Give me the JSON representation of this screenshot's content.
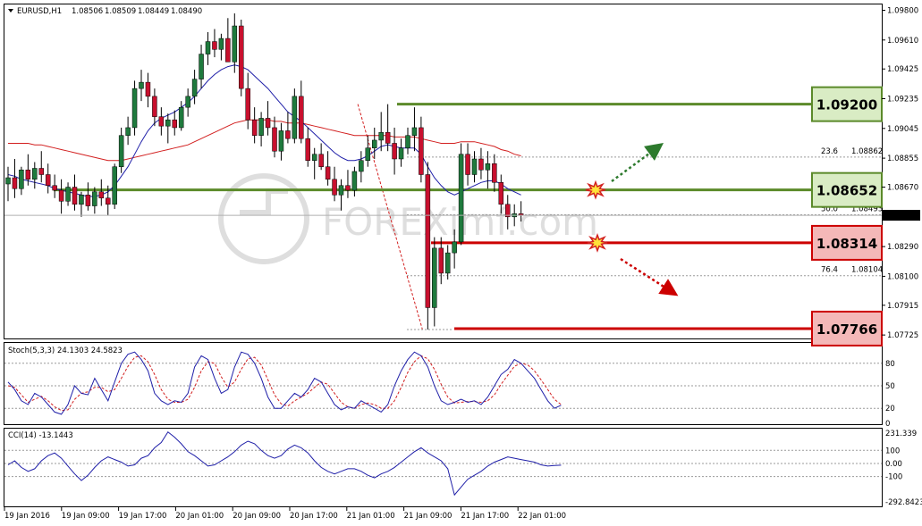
{
  "chart_data": {
    "type": "candlestick",
    "symbol_header": {
      "symbol": "EURUSD,H1",
      "open": "1.08506",
      "high": "1.08509",
      "low": "1.08449",
      "close": "1.08490"
    },
    "watermark": "FOREXimf.com",
    "ylim": [
      1.0772,
      1.0982
    ],
    "price_ticks": [
      "1.09800",
      "1.09610",
      "1.09425",
      "1.09235",
      "1.09045",
      "1.08855",
      "1.08670",
      "1.08490",
      "1.08290",
      "1.08100",
      "1.07915",
      "1.07725"
    ],
    "current_price": "1.08490",
    "x_ticks": [
      "19 Jan 2016",
      "19 Jan 09:00",
      "19 Jan 17:00",
      "20 Jan 01:00",
      "20 Jan 09:00",
      "20 Jan 17:00",
      "21 Jan 01:00",
      "21 Jan 09:00",
      "21 Jan 17:00",
      "22 Jan 01:00"
    ],
    "candles": [
      [
        1.0869,
        1.088,
        1.0858,
        1.0873
      ],
      [
        1.0873,
        1.0885,
        1.086,
        1.0866
      ],
      [
        1.0866,
        1.088,
        1.0862,
        1.0878
      ],
      [
        1.0878,
        1.0888,
        1.0868,
        1.0872
      ],
      [
        1.0872,
        1.0883,
        1.0866,
        1.0879
      ],
      [
        1.0879,
        1.089,
        1.087,
        1.0875
      ],
      [
        1.0875,
        1.0882,
        1.0863,
        1.0868
      ],
      [
        1.0868,
        1.0875,
        1.086,
        1.0865
      ],
      [
        1.0865,
        1.0872,
        1.085,
        1.0858
      ],
      [
        1.0858,
        1.087,
        1.0855,
        1.0867
      ],
      [
        1.0867,
        1.0875,
        1.0852,
        1.0856
      ],
      [
        1.0856,
        1.0864,
        1.0848,
        1.0862
      ],
      [
        1.0862,
        1.087,
        1.0852,
        1.0855
      ],
      [
        1.0855,
        1.0867,
        1.085,
        1.0864
      ],
      [
        1.0864,
        1.0872,
        1.0855,
        1.086
      ],
      [
        1.086,
        1.0868,
        1.0849,
        1.0856
      ],
      [
        1.0856,
        1.0882,
        1.0853,
        1.088
      ],
      [
        1.088,
        1.0905,
        1.0876,
        1.09
      ],
      [
        1.09,
        1.0912,
        1.0894,
        1.0905
      ],
      [
        1.0905,
        1.0935,
        1.09,
        1.093
      ],
      [
        1.093,
        1.0942,
        1.0922,
        1.0934
      ],
      [
        1.0934,
        1.094,
        1.0918,
        1.0925
      ],
      [
        1.0925,
        1.093,
        1.0906,
        1.0912
      ],
      [
        1.0912,
        1.0918,
        1.09,
        1.0906
      ],
      [
        1.0906,
        1.0914,
        1.0895,
        1.091
      ],
      [
        1.091,
        1.0916,
        1.09,
        1.0905
      ],
      [
        1.0905,
        1.0922,
        1.0903,
        1.0918
      ],
      [
        1.0918,
        1.093,
        1.0912,
        1.0925
      ],
      [
        1.0925,
        1.0942,
        1.092,
        1.0936
      ],
      [
        1.0936,
        1.0958,
        1.093,
        1.0952
      ],
      [
        1.0952,
        1.0966,
        1.0945,
        1.096
      ],
      [
        1.096,
        1.0968,
        1.095,
        1.0955
      ],
      [
        1.0955,
        1.0965,
        1.0948,
        1.0962
      ],
      [
        1.0962,
        1.0975,
        1.0955,
        1.0947
      ],
      [
        1.0947,
        1.0978,
        1.094,
        1.097
      ],
      [
        1.097,
        1.0974,
        1.0925,
        1.093
      ],
      [
        1.093,
        1.094,
        1.0904,
        1.091
      ],
      [
        1.091,
        1.0918,
        1.0895,
        1.09
      ],
      [
        1.09,
        1.0915,
        1.0893,
        1.0911
      ],
      [
        1.0911,
        1.0922,
        1.09,
        1.0905
      ],
      [
        1.0905,
        1.0912,
        1.0886,
        1.089
      ],
      [
        1.089,
        1.0908,
        1.0884,
        1.0903
      ],
      [
        1.0903,
        1.0915,
        1.0895,
        1.0898
      ],
      [
        1.0898,
        1.093,
        1.0895,
        1.0925
      ],
      [
        1.0925,
        1.0935,
        1.0895,
        1.0898
      ],
      [
        1.0898,
        1.0905,
        1.088,
        1.0884
      ],
      [
        1.0884,
        1.0892,
        1.0872,
        1.0888
      ],
      [
        1.0888,
        1.0895,
        1.0878,
        1.088
      ],
      [
        1.088,
        1.089,
        1.0868,
        1.0872
      ],
      [
        1.0872,
        1.088,
        1.0858,
        1.0862
      ],
      [
        1.0862,
        1.0872,
        1.0852,
        1.0868
      ],
      [
        1.0868,
        1.0878,
        1.086,
        1.0865
      ],
      [
        1.0865,
        1.088,
        1.0861,
        1.0877
      ],
      [
        1.0877,
        1.089,
        1.087,
        1.0884
      ],
      [
        1.0884,
        1.09,
        1.088,
        1.0892
      ],
      [
        1.0892,
        1.0905,
        1.0885,
        1.0897
      ],
      [
        1.0897,
        1.0915,
        1.089,
        1.0902
      ],
      [
        1.0902,
        1.092,
        1.089,
        1.0895
      ],
      [
        1.0895,
        1.0905,
        1.0875,
        1.0885
      ],
      [
        1.0885,
        1.0898,
        1.088,
        1.0892
      ],
      [
        1.0892,
        1.0905,
        1.0888,
        1.09
      ],
      [
        1.09,
        1.0918,
        1.089,
        1.0905
      ],
      [
        1.0905,
        1.0912,
        1.087,
        1.0875
      ],
      [
        1.0875,
        1.0883,
        1.0776,
        1.079
      ],
      [
        1.079,
        1.0835,
        1.0778,
        1.0828
      ],
      [
        1.0828,
        1.0835,
        1.0805,
        1.0812
      ],
      [
        1.0812,
        1.083,
        1.0808,
        1.0825
      ],
      [
        1.0825,
        1.084,
        1.0815,
        1.0832
      ],
      [
        1.0832,
        1.0895,
        1.083,
        1.0888
      ],
      [
        1.0888,
        1.0895,
        1.0868,
        1.0875
      ],
      [
        1.0875,
        1.089,
        1.087,
        1.0885
      ],
      [
        1.0885,
        1.0892,
        1.0872,
        1.0878
      ],
      [
        1.0878,
        1.089,
        1.0866,
        1.0882
      ],
      [
        1.0882,
        1.0888,
        1.0864,
        1.087
      ],
      [
        1.087,
        1.0875,
        1.085,
        1.0856
      ],
      [
        1.0856,
        1.0862,
        1.084,
        1.0848
      ],
      [
        1.0848,
        1.0856,
        1.0842,
        1.085
      ],
      [
        1.085,
        1.0858,
        1.0845,
        1.0849
      ]
    ],
    "ma_fast": [
      1.0875,
      1.0874,
      1.0872,
      1.0871,
      1.087,
      1.0869,
      1.0868,
      1.0866,
      1.0865,
      1.0864,
      1.0863,
      1.0862,
      1.0861,
      1.0861,
      1.0862,
      1.0864,
      1.0868,
      1.0874,
      1.088,
      1.0888,
      1.0896,
      1.0903,
      1.0908,
      1.0911,
      1.0913,
      1.0915,
      1.0918,
      1.0921,
      1.0925,
      1.093,
      1.0935,
      1.0939,
      1.0942,
      1.0944,
      1.0945,
      1.0944,
      1.0942,
      1.0938,
      1.0934,
      1.093,
      1.0925,
      1.092,
      1.0915,
      1.0912,
      1.0909,
      1.0905,
      1.0901,
      1.0897,
      1.0893,
      1.0889,
      1.0886,
      1.0884,
      1.0884,
      1.0885,
      1.0887,
      1.089,
      1.0893,
      1.0894,
      1.0893,
      1.0892,
      1.0892,
      1.0892,
      1.0888,
      1.088,
      1.0873,
      1.0868,
      1.0864,
      1.0862,
      1.0864,
      1.0866,
      1.0868,
      1.087,
      1.0871,
      1.0871,
      1.0869,
      1.0866,
      1.0864,
      1.0862
    ],
    "ma_slow": [
      1.0895,
      1.0895,
      1.0895,
      1.0895,
      1.0894,
      1.0894,
      1.0893,
      1.0892,
      1.0891,
      1.089,
      1.0889,
      1.0888,
      1.0887,
      1.0886,
      1.0885,
      1.0884,
      1.0884,
      1.0884,
      1.0885,
      1.0886,
      1.0887,
      1.0888,
      1.0889,
      1.089,
      1.0891,
      1.0892,
      1.0893,
      1.0894,
      1.0896,
      1.0898,
      1.09,
      1.0902,
      1.0904,
      1.0906,
      1.0908,
      1.0909,
      1.091,
      1.091,
      1.091,
      1.091,
      1.0909,
      1.0909,
      1.0908,
      1.0908,
      1.0908,
      1.0907,
      1.0906,
      1.0905,
      1.0904,
      1.0903,
      1.0902,
      1.0901,
      1.09,
      1.09,
      1.09,
      1.09,
      1.09,
      1.09,
      1.0899,
      1.0899,
      1.0899,
      1.0899,
      1.0898,
      1.0897,
      1.0896,
      1.0895,
      1.0895,
      1.0895,
      1.0896,
      1.0896,
      1.0896,
      1.0895,
      1.0894,
      1.0893,
      1.0891,
      1.089,
      1.0888,
      1.0887
    ],
    "levels": [
      {
        "label": "1.09200",
        "price": 1.092,
        "color": "#5b8a2a",
        "label_bg": "#d9ecc4"
      },
      {
        "label": "1.08652",
        "price": 1.08652,
        "color": "#5b8a2a",
        "label_bg": "#d9ecc4"
      },
      {
        "label": "1.08314",
        "price": 1.08314,
        "color": "#cc0000",
        "label_bg": "#f4b8b8"
      },
      {
        "label": "1.07766",
        "price": 1.07766,
        "color": "#cc0000",
        "label_bg": "#f4b8b8"
      }
    ],
    "fib_levels": [
      {
        "pct": "23.6",
        "value": "1.08862",
        "price": 1.08862
      },
      {
        "pct": "50.0",
        "value": "1.08493",
        "price": 1.08493
      },
      {
        "pct": "76.4",
        "value": "1.08104",
        "price": 1.08104
      }
    ],
    "stochastic": {
      "label": "Stoch(5,3,3) 24.1303 24.5823",
      "levels": [
        "80",
        "50",
        "20",
        "0"
      ],
      "k": [
        55,
        45,
        30,
        25,
        40,
        35,
        25,
        15,
        12,
        25,
        50,
        40,
        38,
        60,
        45,
        30,
        55,
        80,
        92,
        95,
        85,
        70,
        40,
        30,
        25,
        30,
        28,
        40,
        75,
        90,
        85,
        60,
        40,
        45,
        75,
        95,
        92,
        80,
        60,
        35,
        20,
        20,
        30,
        40,
        35,
        45,
        60,
        55,
        40,
        25,
        18,
        22,
        20,
        30,
        25,
        20,
        15,
        25,
        50,
        70,
        85,
        95,
        90,
        75,
        50,
        30,
        25,
        28,
        32,
        28,
        30,
        25,
        35,
        50,
        65,
        72,
        85,
        80,
        70,
        60,
        45,
        30,
        20,
        24
      ],
      "d": [
        50,
        48,
        38,
        28,
        32,
        36,
        30,
        22,
        17,
        18,
        32,
        40,
        42,
        48,
        48,
        42,
        45,
        60,
        76,
        88,
        90,
        82,
        65,
        45,
        32,
        28,
        28,
        32,
        48,
        70,
        82,
        80,
        62,
        48,
        55,
        72,
        86,
        88,
        78,
        58,
        38,
        26,
        23,
        30,
        35,
        40,
        48,
        55,
        52,
        40,
        28,
        22,
        20,
        25,
        27,
        25,
        20,
        20,
        30,
        48,
        68,
        82,
        90,
        86,
        72,
        52,
        35,
        27,
        28,
        29,
        29,
        28,
        30,
        38,
        52,
        64,
        76,
        80,
        78,
        70,
        58,
        45,
        32,
        25
      ]
    },
    "cci": {
      "label": "CCI(14) -13.1443",
      "levels": [
        "231.339",
        "100",
        "0.00",
        "-100",
        "-292.8423"
      ],
      "values": [
        -10,
        20,
        -30,
        -60,
        -40,
        20,
        60,
        80,
        40,
        -20,
        -80,
        -130,
        -90,
        -30,
        20,
        50,
        30,
        10,
        -20,
        -10,
        40,
        60,
        120,
        160,
        240,
        200,
        150,
        90,
        60,
        20,
        -20,
        -10,
        20,
        50,
        90,
        140,
        170,
        150,
        100,
        60,
        40,
        60,
        110,
        140,
        120,
        80,
        20,
        -30,
        -60,
        -80,
        -60,
        -40,
        -40,
        -60,
        -90,
        -110,
        -80,
        -60,
        -30,
        10,
        50,
        90,
        120,
        80,
        50,
        20,
        -40,
        -240,
        -180,
        -120,
        -90,
        -60,
        -20,
        10,
        30,
        50,
        40,
        30,
        20,
        10,
        -10,
        -20,
        -15,
        -13
      ]
    },
    "annotations": {
      "arrow_up": {
        "color": "#2d7a2d"
      },
      "arrow_down": {
        "color": "#cc0000"
      },
      "bursts": [
        "breakout-burst-upper",
        "breakout-burst-lower"
      ]
    },
    "colors": {
      "bull": "#1f7a3d",
      "bear": "#c8102e",
      "ma_fast": "#1f1fa8",
      "ma_slow": "#d21f1f",
      "stoch_k": "#1f1fa8",
      "stoch_d": "#d21f1f",
      "cci": "#1f1fa8",
      "grid": "#9a9a9a"
    }
  }
}
